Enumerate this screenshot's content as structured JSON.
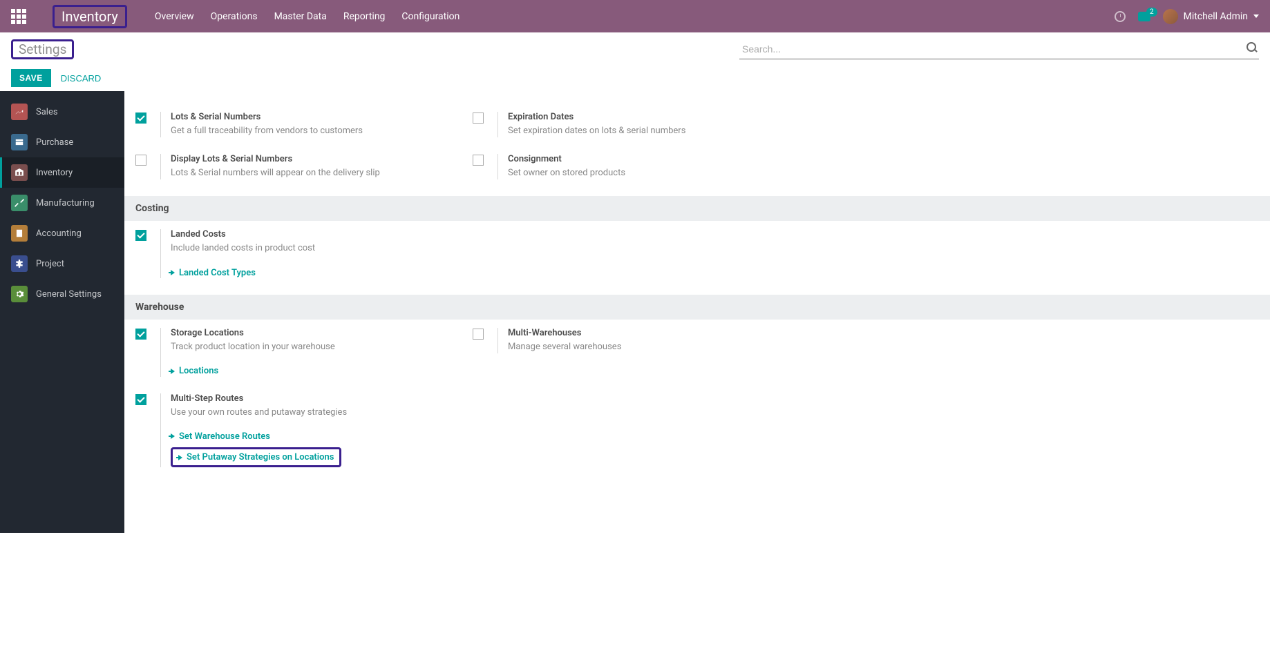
{
  "topbar": {
    "brand": "Inventory",
    "nav": [
      "Overview",
      "Operations",
      "Master Data",
      "Reporting",
      "Configuration"
    ],
    "msg_count": "2",
    "user": "Mitchell Admin"
  },
  "subheader": {
    "title": "Settings",
    "search_placeholder": "Search...",
    "save": "SAVE",
    "discard": "DISCARD"
  },
  "sidebar": [
    {
      "label": "Sales",
      "color": "#b45453"
    },
    {
      "label": "Purchase",
      "color": "#3a6a8e"
    },
    {
      "label": "Inventory",
      "color": "#7a4e4e",
      "active": true
    },
    {
      "label": "Manufacturing",
      "color": "#3a8e6a"
    },
    {
      "label": "Accounting",
      "color": "#b47e3a"
    },
    {
      "label": "Project",
      "color": "#3a4e8e"
    },
    {
      "label": "General Settings",
      "color": "#5a8e3a"
    }
  ],
  "settings": {
    "row1": {
      "left": {
        "title": "Lots & Serial Numbers",
        "desc": "Get a full traceability from vendors to customers",
        "checked": true
      },
      "right": {
        "title": "Expiration Dates",
        "desc": "Set expiration dates on lots & serial numbers",
        "checked": false
      }
    },
    "row2": {
      "left": {
        "title": "Display Lots & Serial Numbers",
        "desc": "Lots & Serial numbers will appear on the delivery slip",
        "checked": false
      },
      "right": {
        "title": "Consignment",
        "desc": "Set owner on stored products",
        "checked": false
      }
    },
    "costing_header": "Costing",
    "costing": {
      "left": {
        "title": "Landed Costs",
        "desc": "Include landed costs in product cost",
        "checked": true,
        "link": "Landed Cost Types"
      }
    },
    "warehouse_header": "Warehouse",
    "wh_row1": {
      "left": {
        "title": "Storage Locations",
        "desc": "Track product location in your warehouse",
        "checked": true,
        "link": "Locations"
      },
      "right": {
        "title": "Multi-Warehouses",
        "desc": "Manage several warehouses",
        "checked": false
      }
    },
    "wh_row2": {
      "left": {
        "title": "Multi-Step Routes",
        "desc": "Use your own routes and putaway strategies",
        "checked": true,
        "link1": "Set Warehouse Routes",
        "link2": "Set Putaway Strategies on Locations"
      }
    }
  }
}
